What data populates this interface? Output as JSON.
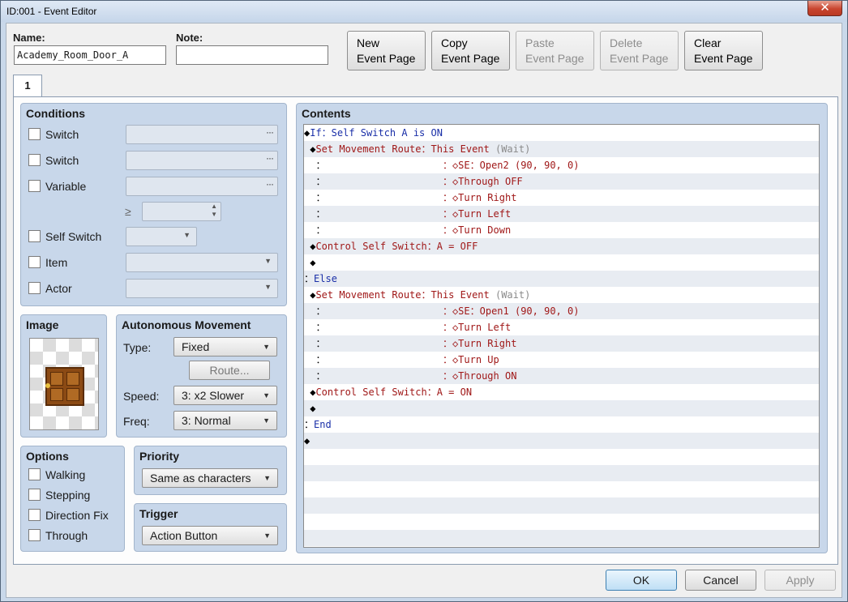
{
  "window": {
    "title": "ID:001 - Event Editor",
    "close_glyph": "✕"
  },
  "header": {
    "name_label": "Name:",
    "name_value": "Academy_Room_Door_A",
    "note_label": "Note:",
    "note_value": ""
  },
  "page_buttons": [
    {
      "line1": "New",
      "line2": "Event Page",
      "enabled": true
    },
    {
      "line1": "Copy",
      "line2": "Event Page",
      "enabled": true
    },
    {
      "line1": "Paste",
      "line2": "Event Page",
      "enabled": false
    },
    {
      "line1": "Delete",
      "line2": "Event Page",
      "enabled": false
    },
    {
      "line1": "Clear",
      "line2": "Event Page",
      "enabled": true
    }
  ],
  "tabs": [
    {
      "label": "1"
    }
  ],
  "conditions": {
    "title": "Conditions",
    "switch1_label": "Switch",
    "switch2_label": "Switch",
    "variable_label": "Variable",
    "dots": "···",
    "operator": "≥",
    "self_switch_label": "Self Switch",
    "item_label": "Item",
    "actor_label": "Actor"
  },
  "image": {
    "title": "Image",
    "sprite": "door-icon"
  },
  "autonomous": {
    "title": "Autonomous Movement",
    "type_label": "Type:",
    "type_value": "Fixed",
    "route_label": "Route...",
    "speed_label": "Speed:",
    "speed_value": "3: x2 Slower",
    "freq_label": "Freq:",
    "freq_value": "3: Normal"
  },
  "options": {
    "title": "Options",
    "walking": "Walking",
    "stepping": "Stepping",
    "direction_fix": "Direction Fix",
    "through": "Through"
  },
  "priority": {
    "title": "Priority",
    "value": "Same as characters"
  },
  "trigger": {
    "title": "Trigger",
    "value": "Action Button"
  },
  "contents": {
    "title": "Contents",
    "rows": [
      [
        "◆",
        "If：Self Switch A is ON"
      ],
      [
        " ◆",
        "Set Movement Route：",
        "This Event ",
        "(Wait)"
      ],
      [
        "  ：",
        "                    ：◇SE：Open2 (90, 90, 0)"
      ],
      [
        "  ：",
        "                    ：◇Through OFF"
      ],
      [
        "  ：",
        "                    ：◇Turn Right"
      ],
      [
        "  ：",
        "                    ：◇Turn Left"
      ],
      [
        "  ：",
        "                    ：◇Turn Down"
      ],
      [
        " ◆",
        "Control Self Switch：A = OFF"
      ],
      [
        " ◆",
        ""
      ],
      [
        "：",
        "Else"
      ],
      [
        " ◆",
        "Set Movement Route：",
        "This Event ",
        "(Wait)"
      ],
      [
        "  ：",
        "                    ：◇SE：Open1 (90, 90, 0)"
      ],
      [
        "  ：",
        "                    ：◇Turn Left"
      ],
      [
        "  ：",
        "                    ：◇Turn Right"
      ],
      [
        "  ：",
        "                    ：◇Turn Up"
      ],
      [
        "  ：",
        "                    ：◇Through ON"
      ],
      [
        " ◆",
        "Control Self Switch：A = ON"
      ],
      [
        " ◆",
        ""
      ],
      [
        "：",
        "End"
      ],
      [
        "◆",
        ""
      ]
    ]
  },
  "footer": {
    "ok": "OK",
    "cancel": "Cancel",
    "apply": "Apply"
  }
}
